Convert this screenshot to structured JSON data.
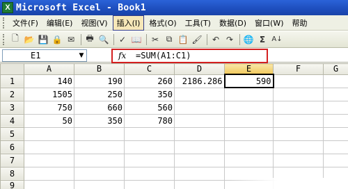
{
  "app": {
    "title": "Microsoft Excel - Book1",
    "icon_letter": "X"
  },
  "menu": {
    "items": [
      "文件(F)",
      "编辑(E)",
      "视图(V)",
      "插入(I)",
      "格式(O)",
      "工具(T)",
      "数据(D)",
      "窗口(W)",
      "帮助"
    ],
    "active": "插入(I)"
  },
  "toolbar": {
    "icons": [
      "new-icon",
      "open-icon",
      "save-icon",
      "permission-icon",
      "email-icon",
      "print-icon",
      "print-preview-icon",
      "spelling-icon",
      "research-icon",
      "cut-icon",
      "copy-icon",
      "paste-icon",
      "format-painter-icon",
      "undo-icon",
      "redo-icon",
      "hyperlink-icon",
      "autosum-icon",
      "sort-ascending-icon"
    ],
    "autosum_label": "Σ",
    "sort_label": "A↓"
  },
  "formula_bar": {
    "name_box": "E1",
    "fx_label": "fx",
    "formula": "=SUM(A1:C1)"
  },
  "sheet": {
    "columns": [
      "A",
      "B",
      "C",
      "D",
      "E",
      "F",
      "G"
    ],
    "selected_column": "E",
    "selected_cell": "E1",
    "rows": [
      {
        "num": "1",
        "cells": [
          "140",
          "190",
          "260",
          "2186.286",
          "590",
          "",
          ""
        ]
      },
      {
        "num": "2",
        "cells": [
          "1505",
          "250",
          "350",
          "",
          "",
          "",
          ""
        ]
      },
      {
        "num": "3",
        "cells": [
          "750",
          "660",
          "560",
          "",
          "",
          "",
          ""
        ]
      },
      {
        "num": "4",
        "cells": [
          "50",
          "350",
          "780",
          "",
          "",
          "",
          ""
        ]
      },
      {
        "num": "5",
        "cells": [
          "",
          "",
          "",
          "",
          "",
          "",
          ""
        ]
      },
      {
        "num": "6",
        "cells": [
          "",
          "",
          "",
          "",
          "",
          "",
          ""
        ]
      },
      {
        "num": "7",
        "cells": [
          "",
          "",
          "",
          "",
          "",
          "",
          ""
        ]
      },
      {
        "num": "8",
        "cells": [
          "",
          "",
          "",
          "",
          "",
          "",
          ""
        ]
      },
      {
        "num": "9",
        "cells": [
          "",
          "",
          "",
          "",
          "",
          "",
          ""
        ]
      }
    ]
  },
  "colors": {
    "title_bar": "#1e4fbf",
    "highlight_frame": "#d42020",
    "selected_column_header": "#f1c95c"
  }
}
